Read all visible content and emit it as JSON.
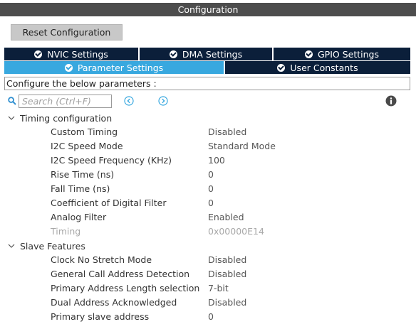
{
  "window": {
    "title": "Configuration"
  },
  "toolbar": {
    "reset_label": "Reset Configuration"
  },
  "tabs": [
    {
      "label": "NVIC Settings"
    },
    {
      "label": "DMA Settings"
    },
    {
      "label": "GPIO Settings"
    },
    {
      "label": "Parameter Settings"
    },
    {
      "label": "User Constants"
    }
  ],
  "description": "Configure the below parameters :",
  "search": {
    "placeholder": "Search (Ctrl+F)",
    "value": ""
  },
  "colors": {
    "title_bar": "#4d4d4d",
    "tab_dark": "#0b1f3a",
    "tab_active": "#38a8df"
  },
  "groups": [
    {
      "title": "Timing configuration",
      "params": [
        {
          "name": "Custom Timing",
          "value": "Disabled"
        },
        {
          "name": "I2C Speed Mode",
          "value": "Standard Mode"
        },
        {
          "name": "I2C Speed Frequency (KHz)",
          "value": "100"
        },
        {
          "name": "Rise Time (ns)",
          "value": "0"
        },
        {
          "name": "Fall Time (ns)",
          "value": "0"
        },
        {
          "name": "Coefficient of Digital Filter",
          "value": "0"
        },
        {
          "name": "Analog Filter",
          "value": "Enabled"
        },
        {
          "name": "Timing",
          "value": "0x00000E14"
        }
      ]
    },
    {
      "title": "Slave Features",
      "params": [
        {
          "name": "Clock No Stretch Mode",
          "value": "Disabled"
        },
        {
          "name": "General Call Address Detection",
          "value": "Disabled"
        },
        {
          "name": "Primary Address Length selection",
          "value": "7-bit"
        },
        {
          "name": "Dual Address Acknowledged",
          "value": "Disabled"
        },
        {
          "name": "Primary slave address",
          "value": "0"
        }
      ]
    }
  ]
}
